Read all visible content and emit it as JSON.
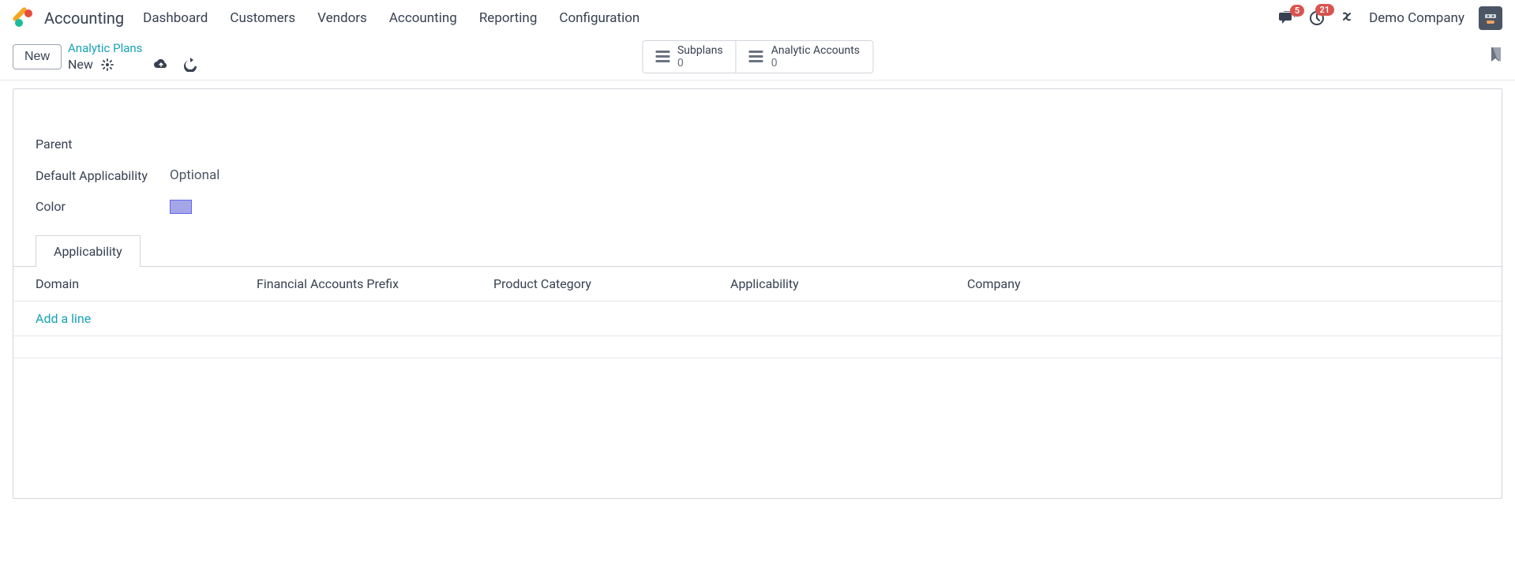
{
  "app_title": "Accounting",
  "nav": [
    "Dashboard",
    "Customers",
    "Vendors",
    "Accounting",
    "Reporting",
    "Configuration"
  ],
  "badges": {
    "messages": "5",
    "activities": "21"
  },
  "company": "Demo Company",
  "new_button": "New",
  "breadcrumb": {
    "parent": "Analytic Plans",
    "current": "New"
  },
  "stats": {
    "subplans": {
      "label": "Subplans",
      "count": "0"
    },
    "accounts": {
      "label": "Analytic Accounts",
      "count": "0"
    }
  },
  "fields": {
    "parent_label": "Parent",
    "default_applicability_label": "Default Applicability",
    "default_applicability_value": "Optional",
    "color_label": "Color"
  },
  "tabs": {
    "applicability": "Applicability"
  },
  "columns": {
    "domain": "Domain",
    "prefix": "Financial Accounts Prefix",
    "category": "Product Category",
    "applicability": "Applicability",
    "company": "Company"
  },
  "add_line": "Add a line"
}
